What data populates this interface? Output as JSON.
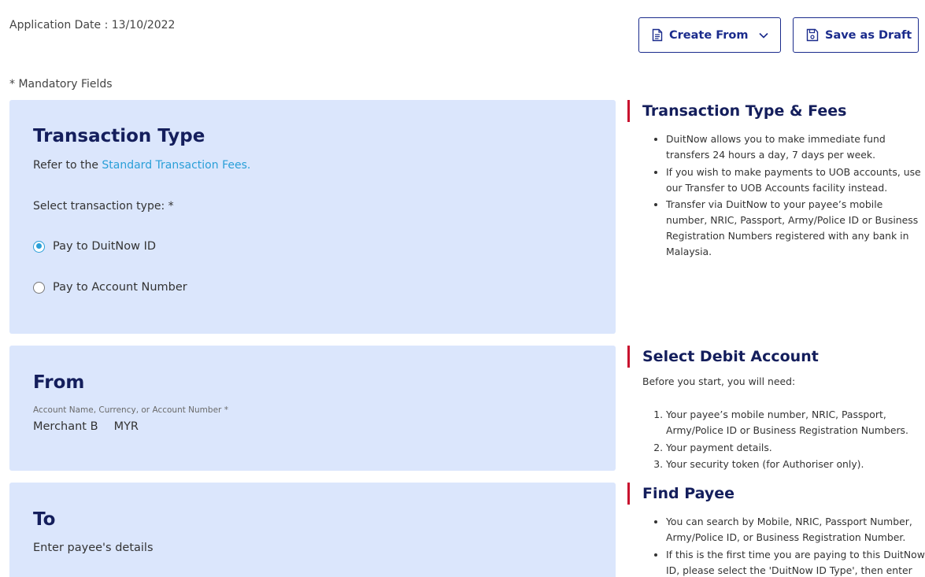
{
  "header": {
    "application_date": "Application Date : 13/10/2022",
    "mandatory_note": "* Mandatory Fields",
    "create_from_label": "Create From",
    "save_draft_label": "Save as Draft"
  },
  "transaction_type": {
    "title": "Transaction Type",
    "refer_prefix": "Refer to the ",
    "refer_link": "Standard Transaction Fees.",
    "select_label": "Select transaction type: *",
    "options": [
      {
        "label": "Pay to DuitNow ID",
        "selected": true
      },
      {
        "label": "Pay to Account Number",
        "selected": false
      }
    ]
  },
  "from": {
    "title": "From",
    "account_caption": "Account Name, Currency, or Account Number *",
    "account_name": "Merchant B",
    "currency": "MYR"
  },
  "to": {
    "title": "To",
    "subtitle": "Enter payee's details"
  },
  "side_fees": {
    "title": "Transaction Type & Fees",
    "items": [
      "DuitNow allows you to make immediate fund transfers 24 hours a day, 7 days per week.",
      "If you wish to make payments to UOB accounts, use our Transfer to UOB Accounts facility instead.",
      "Transfer via DuitNow to your payee’s mobile number, NRIC, Passport, Army/Police ID or Business Registration Numbers registered with any bank in Malaysia."
    ]
  },
  "side_debit": {
    "title": "Select Debit Account",
    "intro": "Before you start, you will need:",
    "items": [
      "Your payee’s mobile number, NRIC, Passport, Army/Police ID or Business Registration Numbers.",
      "Your payment details.",
      "Your security token (for Authoriser only)."
    ]
  },
  "side_payee": {
    "title": "Find Payee",
    "items": [
      "You can search by Mobile, NRIC, Passport Number, Army/Police ID, or Business Registration Number.",
      "If this is the first time you are paying to this DuitNow ID, please select the 'DuitNow ID Type', then enter"
    ]
  },
  "colors": {
    "brand_navy": "#141e5c",
    "button_blue": "#1a2b8c",
    "panel_bg": "#dbe6fc",
    "link": "#2a9fd8",
    "accent_red": "#c8102e"
  },
  "icons": {
    "create_from": "document-icon",
    "dropdown": "chevron-down-icon",
    "save_draft": "save-icon"
  }
}
